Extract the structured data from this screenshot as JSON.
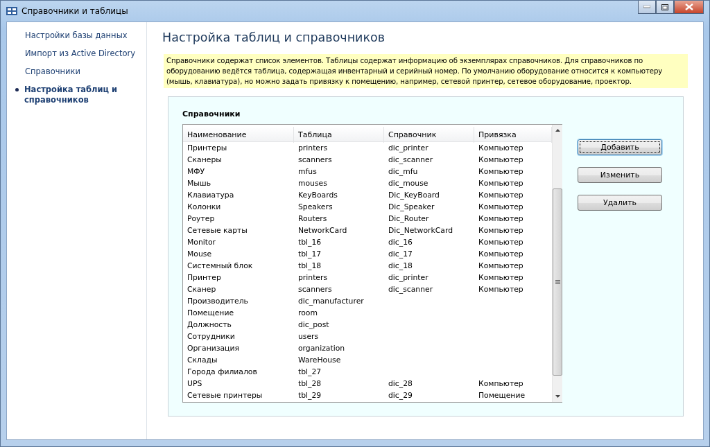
{
  "window": {
    "title": "Справочники и таблицы"
  },
  "sidebar": {
    "items": [
      {
        "label": "Настройки базы данных",
        "selected": false
      },
      {
        "label": "Импорт из Active Directory",
        "selected": false
      },
      {
        "label": "Справочники",
        "selected": false
      },
      {
        "label": "Настройка таблиц  и справочников",
        "selected": true
      }
    ]
  },
  "page_title": "Настройка таблиц и справочников",
  "info": "Справочники содержат список элементов. Таблицы содержат информацию об экземплярах справочников. Для справочников по оборудованию ведётся таблица, содержащая инвентарный и серийный номер. По умолчанию оборудование относится к компьютеру (мышь, клавиатура), но можно задать привязку к помещению, например, сетевой принтер, сетевое оборудование, проектор.",
  "group": {
    "title": "Справочники",
    "table": {
      "columns": [
        "Наименование",
        "Таблица",
        "Справочник",
        "Привязка"
      ],
      "rows": [
        [
          "Принтеры",
          "printers",
          "dic_printer",
          "Компьютер"
        ],
        [
          "Сканеры",
          "scanners",
          "dic_scanner",
          "Компьютер"
        ],
        [
          "МФУ",
          "mfus",
          "dic_mfu",
          "Компьютер"
        ],
        [
          "Мышь",
          "mouses",
          "dic_mouse",
          "Компьютер"
        ],
        [
          "Клавиатура",
          "KeyBoards",
          "Dic_KeyBoard",
          "Компьютер"
        ],
        [
          "Колонки",
          "Speakers",
          "Dic_Speaker",
          "Компьютер"
        ],
        [
          "Роутер",
          "Routers",
          "Dic_Router",
          "Компьютер"
        ],
        [
          "Сетевые карты",
          "NetworkCard",
          "Dic_NetworkCard",
          "Компьютер"
        ],
        [
          "Monitor",
          "tbl_16",
          "dic_16",
          "Компьютер"
        ],
        [
          "Mouse",
          "tbl_17",
          "dic_17",
          "Компьютер"
        ],
        [
          "Системный блок",
          "tbl_18",
          "dic_18",
          "Компьютер"
        ],
        [
          "Принтер",
          "printers",
          "dic_printer",
          "Компьютер"
        ],
        [
          "Сканер",
          "scanners",
          "dic_scanner",
          "Компьютер"
        ],
        [
          "Производитель",
          "dic_manufacturer",
          "",
          ""
        ],
        [
          "Помещение",
          "room",
          "",
          ""
        ],
        [
          "Должность",
          "dic_post",
          "",
          ""
        ],
        [
          "Сотрудники",
          "users",
          "",
          ""
        ],
        [
          "Организация",
          "organization",
          "",
          ""
        ],
        [
          "Склады",
          "WareHouse",
          "",
          ""
        ],
        [
          "Города филиалов",
          "tbl_27",
          "",
          ""
        ],
        [
          "UPS",
          "tbl_28",
          "dic_28",
          "Компьютер"
        ],
        [
          "Сетевые принтеры",
          "tbl_29",
          "dic_29",
          "Помещение"
        ]
      ]
    },
    "buttons": [
      {
        "label": "Добавить",
        "focused": true
      },
      {
        "label": "Изменить",
        "focused": false
      },
      {
        "label": "Удалить",
        "focused": false
      }
    ]
  }
}
